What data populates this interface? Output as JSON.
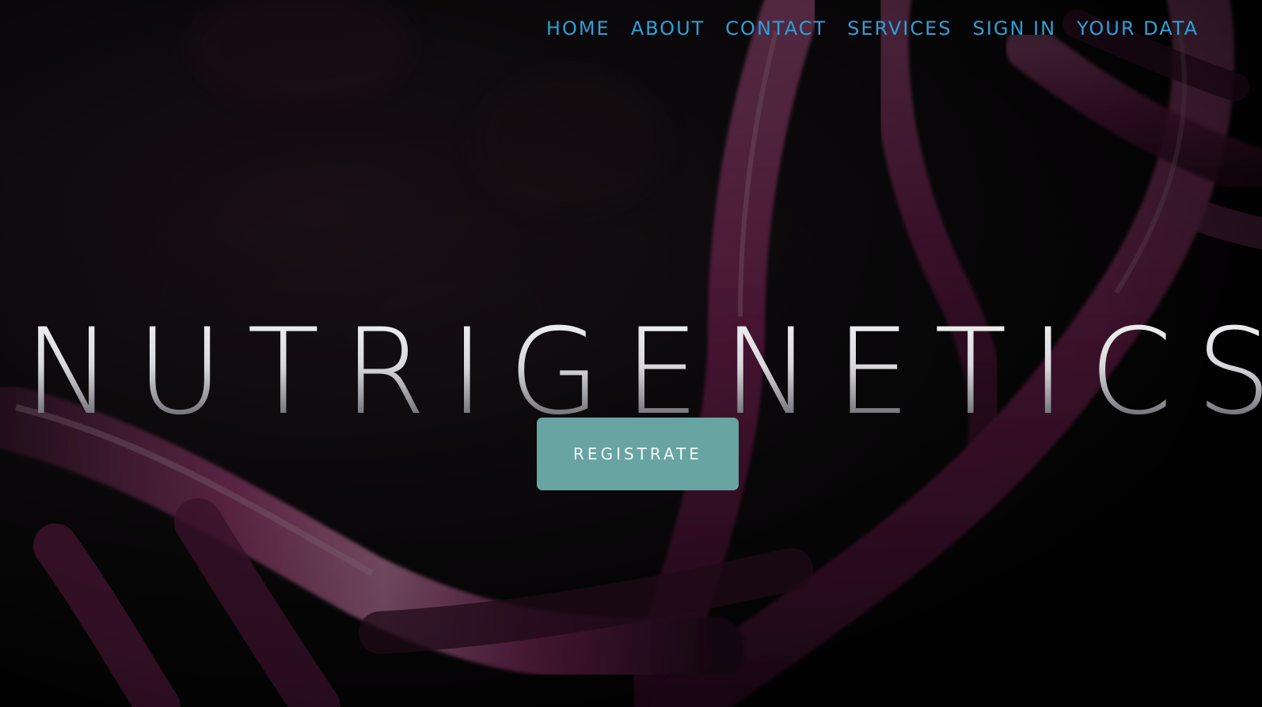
{
  "nav": {
    "items": [
      {
        "label": "HOME"
      },
      {
        "label": "ABOUT"
      },
      {
        "label": "CONTACT"
      },
      {
        "label": "SERVICES"
      },
      {
        "label": "SIGN IN"
      },
      {
        "label": "YOUR DATA"
      }
    ]
  },
  "hero": {
    "title": "NUTRIGENETICS",
    "cta_label": "REGISTRATE"
  },
  "colors": {
    "nav_link": "#2e9fd6",
    "button_bg": "#68a4a1",
    "background": "#0b0a0c",
    "dna_strand": "#8a2e66"
  },
  "background_image": {
    "subject": "dna-double-helix"
  }
}
